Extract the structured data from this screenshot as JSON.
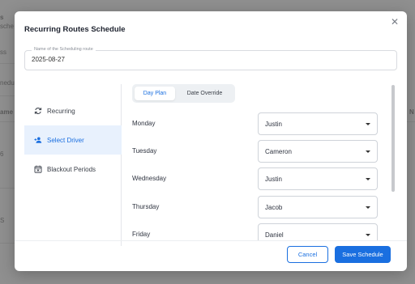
{
  "background": {
    "fragments": [
      "s",
      "sche",
      "ss",
      "nedu",
      "ame",
      "N",
      "6",
      "S"
    ]
  },
  "modal": {
    "title": "Recurring Routes Schedule",
    "close_icon": "close-icon"
  },
  "name_field": {
    "label": "Name of the Scheduling route",
    "value": "2025-08-27"
  },
  "sidebar": {
    "items": [
      {
        "label": "Recurring",
        "icon": "refresh-icon",
        "active": false
      },
      {
        "label": "Select Driver",
        "icon": "person-add-icon",
        "active": true
      },
      {
        "label": "Blackout Periods",
        "icon": "calendar-x-icon",
        "active": false
      }
    ]
  },
  "tabs": [
    {
      "label": "Day Plan",
      "active": true
    },
    {
      "label": "Date Override",
      "active": false
    }
  ],
  "days": [
    {
      "day": "Monday",
      "driver": "Justin"
    },
    {
      "day": "Tuesday",
      "driver": "Cameron"
    },
    {
      "day": "Wednesday",
      "driver": "Justin"
    },
    {
      "day": "Thursday",
      "driver": "Jacob"
    },
    {
      "day": "Friday",
      "driver": "Daniel"
    }
  ],
  "buttons": {
    "cancel": "Cancel",
    "save": "Save Schedule"
  },
  "colors": {
    "accent": "#1a6fe0",
    "active_bg": "#e8f1fd",
    "overlay": "#8f8f8f"
  }
}
